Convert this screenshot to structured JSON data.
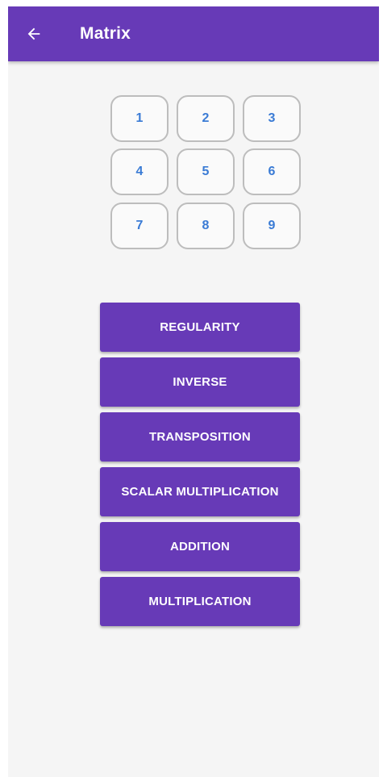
{
  "app_bar": {
    "title": "Matrix",
    "back_icon": "arrow-back-icon",
    "color": "#673ab7"
  },
  "matrix": {
    "cells": [
      "1",
      "2",
      "3",
      "4",
      "5",
      "6",
      "7",
      "8",
      "9"
    ],
    "text_color": "#3a7bd5"
  },
  "operations": [
    {
      "label": "REGULARITY"
    },
    {
      "label": "INVERSE"
    },
    {
      "label": "TRANSPOSITION"
    },
    {
      "label": "SCALAR MULTIPLICATION"
    },
    {
      "label": "ADDITION"
    },
    {
      "label": "MULTIPLICATION"
    }
  ]
}
